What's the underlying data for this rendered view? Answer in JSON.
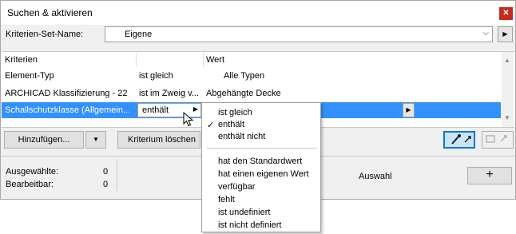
{
  "window": {
    "title": "Suchen & aktivieren",
    "close_glyph": "✕"
  },
  "kriterien_set": {
    "label": "Kriterien-Set-Name:",
    "value": "Eigene",
    "chevron": "⌵",
    "arrow": "▶"
  },
  "table": {
    "headers": {
      "criteria": "Kriterien",
      "value": "Wert"
    },
    "rows": [
      {
        "criterion": "Element-Typ",
        "operator": "ist gleich",
        "value": "Alle Typen"
      },
      {
        "criterion": "ARCHICAD Klassifizierung - 22",
        "operator": "ist im Zweig v...",
        "value": "Abgehängte Decke"
      },
      {
        "criterion": "Schallschutzklasse (Allgemein...",
        "operator": "enthält",
        "value": ""
      }
    ],
    "arrow": "▶",
    "scroll_up": "▲",
    "scroll_down": "▼"
  },
  "buttons": {
    "add": "Hinzufügen...",
    "add_dropdown": "▼",
    "remove_criterion": "Kriterium löschen",
    "plus": "+"
  },
  "stats": {
    "selected_label": "Ausgewählte:",
    "selected_value": "0",
    "editable_label": "Bearbeitbar:",
    "editable_value": "0",
    "selection_label": "Auswahl"
  },
  "menu": {
    "check_glyph": "✓",
    "group1": [
      "ist gleich",
      "enthält",
      "enthält nicht"
    ],
    "checked": "enthält",
    "group2": [
      "hat den Standardwert",
      "hat einen eigenen Wert",
      "verfügbar",
      "fehlt",
      "ist undefiniert",
      "ist nicht definiert"
    ]
  },
  "colors": {
    "selection": "#3390ff",
    "close": "#c42b1c",
    "active_tool": "#0078d7"
  }
}
